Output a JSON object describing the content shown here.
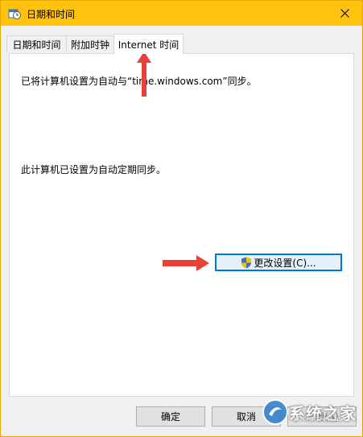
{
  "window": {
    "title": "日期和时间"
  },
  "tabs": [
    {
      "label": "日期和时间"
    },
    {
      "label": "附加时钟"
    },
    {
      "label": "Internet 时间"
    }
  ],
  "panel": {
    "sync_text": "已将计算机设置为自动与“time.windows.com”同步。",
    "schedule_text": "此计算机已设置为自动定期同步。",
    "change_settings_label": "更改设置(C)..."
  },
  "footer": {
    "ok_label": "确定",
    "cancel_label": "取消",
    "apply_label": "应用(A)"
  },
  "watermark": {
    "text": "系统之家",
    "sub": "XITONGZHIJIA.NET"
  },
  "colors": {
    "titlebar": "#ffc20e",
    "annotation_arrow": "#e8413a",
    "accent": "#0078d7"
  }
}
